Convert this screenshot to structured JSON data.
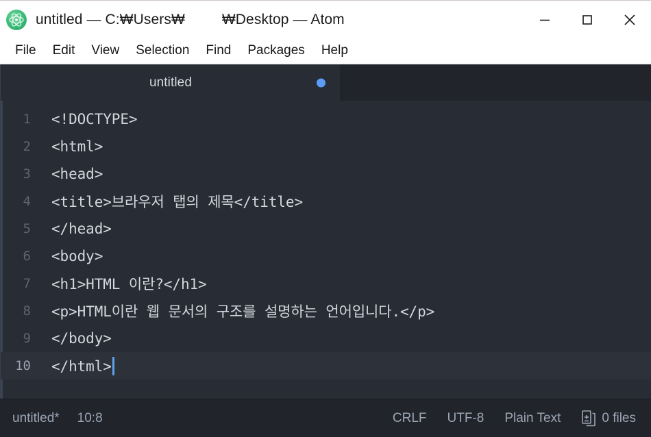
{
  "window": {
    "logo_icon": "atom-logo-icon",
    "title_prefix": "untitled — C:₩Users₩",
    "title_suffix": "₩Desktop — Atom",
    "controls": {
      "minimize": "minimize-icon",
      "maximize": "maximize-icon",
      "close": "close-icon"
    }
  },
  "menubar": {
    "items": [
      {
        "label": "File"
      },
      {
        "label": "Edit"
      },
      {
        "label": "View"
      },
      {
        "label": "Selection"
      },
      {
        "label": "Find"
      },
      {
        "label": "Packages"
      },
      {
        "label": "Help"
      }
    ]
  },
  "tabs": [
    {
      "label": "untitled",
      "modified": true,
      "modified_dot_color": "#5a9cf8"
    }
  ],
  "editor": {
    "active_line": 10,
    "cursor_position": "10:8",
    "lines": [
      {
        "num": "1",
        "text": "<!DOCTYPE>"
      },
      {
        "num": "2",
        "text": "<html>"
      },
      {
        "num": "3",
        "text": "<head>"
      },
      {
        "num": "4",
        "text": "<title>브라우저 탭의 제목</title>"
      },
      {
        "num": "5",
        "text": "</head>"
      },
      {
        "num": "6",
        "text": "<body>"
      },
      {
        "num": "7",
        "text": "<h1>HTML 이란?</h1>"
      },
      {
        "num": "8",
        "text": "<p>HTML이란 웹 문서의 구조를 설명하는 언어입니다.</p>"
      },
      {
        "num": "9",
        "text": "</body>"
      },
      {
        "num": "10",
        "text": "</html>"
      }
    ]
  },
  "statusbar": {
    "file_name": "untitled*",
    "cursor": "10:8",
    "line_ending": "CRLF",
    "encoding": "UTF-8",
    "grammar": "Plain Text",
    "git_icon": "git-diff-icon",
    "git_files": "0 files"
  },
  "colors": {
    "editor_bg": "#282c34",
    "chrome_bg": "#21252b",
    "active_line_bg": "#2c313a",
    "text": "#d4d7de",
    "muted_text": "#9da5b4",
    "gutter_text": "#5d6570",
    "accent_blue": "#5a9cf8",
    "cursor": "#62a0ea",
    "logo_green": "#2fae6b",
    "titlebar_bg": "#ffffff"
  }
}
